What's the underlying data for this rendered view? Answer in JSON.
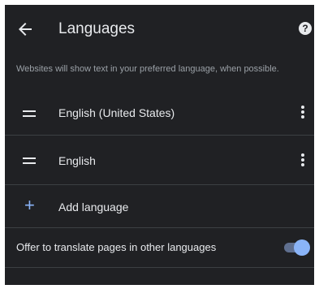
{
  "header": {
    "title": "Languages",
    "back_icon": "arrow-left-icon",
    "help_icon": "help-circle-icon",
    "help_glyph": "?"
  },
  "description": "Websites will show text in your preferred language, when possible.",
  "languages": [
    {
      "label": "English (United States)"
    },
    {
      "label": "English"
    }
  ],
  "add_language": {
    "icon": "plus-icon",
    "glyph": "+",
    "label": "Add language"
  },
  "translate_offer": {
    "label": "Offer to translate pages in other languages",
    "enabled": true
  },
  "colors": {
    "background": "#202124",
    "text": "#e8eaed",
    "secondary_text": "#9aa0a6",
    "accent": "#8ab4f8",
    "divider": "#3c4043"
  }
}
